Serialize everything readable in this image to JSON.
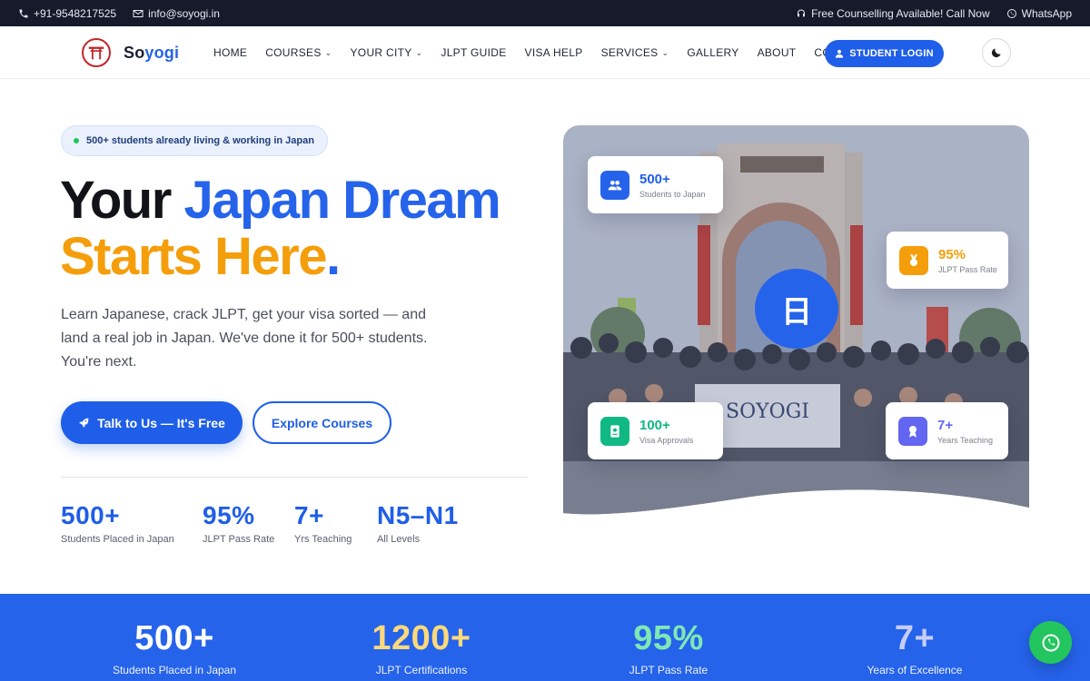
{
  "topbar": {
    "phone": "+91-9548217525",
    "email": "info@soyogi.in",
    "counselling": "Free Counselling Available! Call Now",
    "whatsapp": "WhatsApp"
  },
  "nav": {
    "brand_prefix": "So",
    "brand_accent": "yogi",
    "items": [
      "HOME",
      "COURSES",
      "YOUR CITY",
      "JLPT GUIDE",
      "VISA HELP",
      "SERVICES",
      "GALLERY",
      "ABOUT",
      "CONTACT"
    ],
    "login": "STUDENT LOGIN"
  },
  "hero": {
    "pill": "500+ students already living & working in Japan",
    "title_part1": "Your",
    "title_part2": "Japan Dream",
    "title_part3": "Starts Here",
    "title_dot": ".",
    "lead": "Learn Japanese, crack JLPT, get your visa sorted — and land a real job in Japan. We've done it for 500+ students. You're next.",
    "cta_primary": "Talk to Us — It's Free",
    "cta_secondary": "Explore Courses",
    "stats": [
      {
        "value": "500+",
        "label": "Students Placed in Japan"
      },
      {
        "value": "95%",
        "label": "JLPT Pass Rate"
      },
      {
        "value": "7+",
        "label": "Yrs Teaching"
      },
      {
        "value": "N5–N1",
        "label": "All Levels"
      }
    ]
  },
  "photo": {
    "badge_glyph": "日",
    "banner_text": "SOYOGI",
    "cards": [
      {
        "value": "500+",
        "label": "Students to Japan",
        "color": "#2563eb",
        "icon": "users-icon"
      },
      {
        "value": "95%",
        "label": "JLPT Pass Rate",
        "color": "#f59e0b",
        "icon": "medal-icon"
      },
      {
        "value": "100+",
        "label": "Visa Approvals",
        "color": "#10b981",
        "icon": "passport-icon"
      },
      {
        "value": "7+",
        "label": "Years Teaching",
        "color": "#6366f1",
        "icon": "award-icon"
      }
    ]
  },
  "band": {
    "stats": [
      {
        "value": "500+",
        "label": "Students Placed in Japan",
        "color": "#ffffff"
      },
      {
        "value": "1200+",
        "label": "JLPT Certifications",
        "color": "#fcd97a"
      },
      {
        "value": "95%",
        "label": "JLPT Pass Rate",
        "color": "#7ee8b5"
      },
      {
        "value": "7+",
        "label": "Years of Excellence",
        "color": "#c7cdfb"
      }
    ]
  },
  "colors": {
    "primary": "#2563eb",
    "accent": "#f59e0b",
    "topbar": "#161a2b",
    "whatsapp": "#22c55e"
  }
}
